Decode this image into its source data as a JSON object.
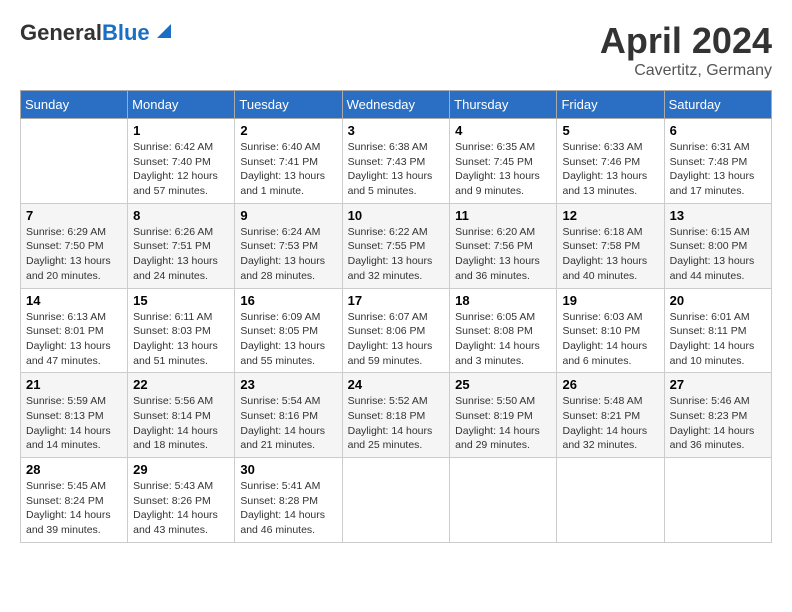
{
  "logo": {
    "general": "General",
    "blue": "Blue"
  },
  "title": "April 2024",
  "location": "Cavertitz, Germany",
  "days_of_week": [
    "Sunday",
    "Monday",
    "Tuesday",
    "Wednesday",
    "Thursday",
    "Friday",
    "Saturday"
  ],
  "weeks": [
    [
      null,
      {
        "day": "1",
        "sunrise": "6:42 AM",
        "sunset": "7:40 PM",
        "daylight": "12 hours and 57 minutes."
      },
      {
        "day": "2",
        "sunrise": "6:40 AM",
        "sunset": "7:41 PM",
        "daylight": "13 hours and 1 minute."
      },
      {
        "day": "3",
        "sunrise": "6:38 AM",
        "sunset": "7:43 PM",
        "daylight": "13 hours and 5 minutes."
      },
      {
        "day": "4",
        "sunrise": "6:35 AM",
        "sunset": "7:45 PM",
        "daylight": "13 hours and 9 minutes."
      },
      {
        "day": "5",
        "sunrise": "6:33 AM",
        "sunset": "7:46 PM",
        "daylight": "13 hours and 13 minutes."
      },
      {
        "day": "6",
        "sunrise": "6:31 AM",
        "sunset": "7:48 PM",
        "daylight": "13 hours and 17 minutes."
      }
    ],
    [
      {
        "day": "7",
        "sunrise": "6:29 AM",
        "sunset": "7:50 PM",
        "daylight": "13 hours and 20 minutes."
      },
      {
        "day": "8",
        "sunrise": "6:26 AM",
        "sunset": "7:51 PM",
        "daylight": "13 hours and 24 minutes."
      },
      {
        "day": "9",
        "sunrise": "6:24 AM",
        "sunset": "7:53 PM",
        "daylight": "13 hours and 28 minutes."
      },
      {
        "day": "10",
        "sunrise": "6:22 AM",
        "sunset": "7:55 PM",
        "daylight": "13 hours and 32 minutes."
      },
      {
        "day": "11",
        "sunrise": "6:20 AM",
        "sunset": "7:56 PM",
        "daylight": "13 hours and 36 minutes."
      },
      {
        "day": "12",
        "sunrise": "6:18 AM",
        "sunset": "7:58 PM",
        "daylight": "13 hours and 40 minutes."
      },
      {
        "day": "13",
        "sunrise": "6:15 AM",
        "sunset": "8:00 PM",
        "daylight": "13 hours and 44 minutes."
      }
    ],
    [
      {
        "day": "14",
        "sunrise": "6:13 AM",
        "sunset": "8:01 PM",
        "daylight": "13 hours and 47 minutes."
      },
      {
        "day": "15",
        "sunrise": "6:11 AM",
        "sunset": "8:03 PM",
        "daylight": "13 hours and 51 minutes."
      },
      {
        "day": "16",
        "sunrise": "6:09 AM",
        "sunset": "8:05 PM",
        "daylight": "13 hours and 55 minutes."
      },
      {
        "day": "17",
        "sunrise": "6:07 AM",
        "sunset": "8:06 PM",
        "daylight": "13 hours and 59 minutes."
      },
      {
        "day": "18",
        "sunrise": "6:05 AM",
        "sunset": "8:08 PM",
        "daylight": "14 hours and 3 minutes."
      },
      {
        "day": "19",
        "sunrise": "6:03 AM",
        "sunset": "8:10 PM",
        "daylight": "14 hours and 6 minutes."
      },
      {
        "day": "20",
        "sunrise": "6:01 AM",
        "sunset": "8:11 PM",
        "daylight": "14 hours and 10 minutes."
      }
    ],
    [
      {
        "day": "21",
        "sunrise": "5:59 AM",
        "sunset": "8:13 PM",
        "daylight": "14 hours and 14 minutes."
      },
      {
        "day": "22",
        "sunrise": "5:56 AM",
        "sunset": "8:14 PM",
        "daylight": "14 hours and 18 minutes."
      },
      {
        "day": "23",
        "sunrise": "5:54 AM",
        "sunset": "8:16 PM",
        "daylight": "14 hours and 21 minutes."
      },
      {
        "day": "24",
        "sunrise": "5:52 AM",
        "sunset": "8:18 PM",
        "daylight": "14 hours and 25 minutes."
      },
      {
        "day": "25",
        "sunrise": "5:50 AM",
        "sunset": "8:19 PM",
        "daylight": "14 hours and 29 minutes."
      },
      {
        "day": "26",
        "sunrise": "5:48 AM",
        "sunset": "8:21 PM",
        "daylight": "14 hours and 32 minutes."
      },
      {
        "day": "27",
        "sunrise": "5:46 AM",
        "sunset": "8:23 PM",
        "daylight": "14 hours and 36 minutes."
      }
    ],
    [
      {
        "day": "28",
        "sunrise": "5:45 AM",
        "sunset": "8:24 PM",
        "daylight": "14 hours and 39 minutes."
      },
      {
        "day": "29",
        "sunrise": "5:43 AM",
        "sunset": "8:26 PM",
        "daylight": "14 hours and 43 minutes."
      },
      {
        "day": "30",
        "sunrise": "5:41 AM",
        "sunset": "8:28 PM",
        "daylight": "14 hours and 46 minutes."
      },
      null,
      null,
      null,
      null
    ]
  ]
}
